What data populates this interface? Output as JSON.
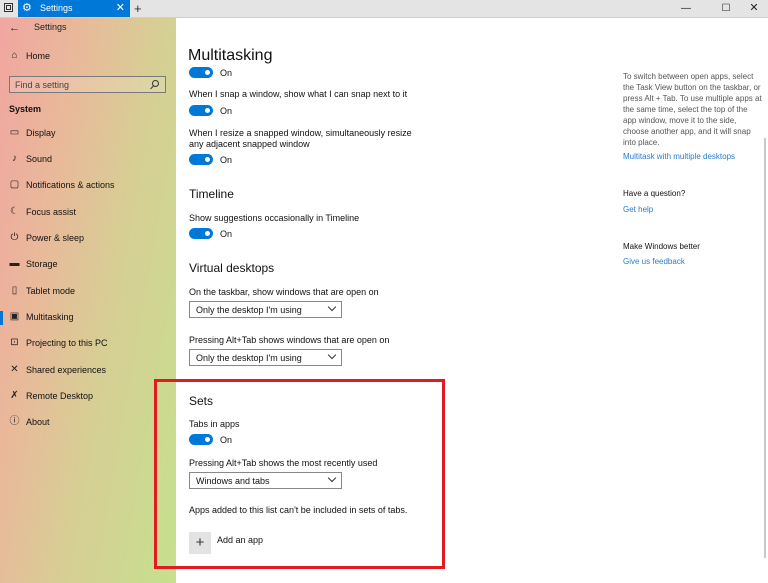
{
  "window": {
    "tab_title": "Settings",
    "app_title": "Settings",
    "new_tab": "+",
    "close_tab": "✕",
    "controls": {
      "minimize": "—",
      "maximize": "☐",
      "close": "✕"
    }
  },
  "sidebar": {
    "back": "←",
    "home": {
      "label": "Home",
      "icon": "home-icon"
    },
    "search": {
      "placeholder": "Find a setting"
    },
    "section": "System",
    "items": [
      {
        "label": "Display",
        "icon": "display-icon"
      },
      {
        "label": "Sound",
        "icon": "sound-icon"
      },
      {
        "label": "Notifications & actions",
        "icon": "notifications-icon"
      },
      {
        "label": "Focus assist",
        "icon": "focus-assist-icon"
      },
      {
        "label": "Power & sleep",
        "icon": "power-icon"
      },
      {
        "label": "Storage",
        "icon": "storage-icon"
      },
      {
        "label": "Tablet mode",
        "icon": "tablet-icon"
      },
      {
        "label": "Multitasking",
        "icon": "multitasking-icon",
        "selected": true
      },
      {
        "label": "Projecting to this PC",
        "icon": "projecting-icon"
      },
      {
        "label": "Shared experiences",
        "icon": "shared-icon"
      },
      {
        "label": "Remote Desktop",
        "icon": "remote-desktop-icon"
      },
      {
        "label": "About",
        "icon": "about-icon"
      }
    ]
  },
  "main": {
    "title": "Multitasking",
    "snap": {
      "toggle1": "On",
      "option2": "When I snap a window, show what I can snap next to it",
      "toggle2": "On",
      "option3": "When I resize a snapped window, simultaneously resize any adjacent snapped window",
      "toggle3": "On"
    },
    "timeline": {
      "heading": "Timeline",
      "option": "Show suggestions occasionally in Timeline",
      "toggle": "On"
    },
    "virtual_desktops": {
      "heading": "Virtual desktops",
      "taskbar_label": "On the taskbar, show windows that are open on",
      "taskbar_value": "Only the desktop I'm using",
      "alttab_label": "Pressing Alt+Tab shows windows that are open on",
      "alttab_value": "Only the desktop I'm using"
    },
    "sets": {
      "heading": "Sets",
      "tabs_label": "Tabs in apps",
      "tabs_toggle": "On",
      "alttab_label": "Pressing Alt+Tab shows the most recently used",
      "alttab_value": "Windows and tabs",
      "exclusion_note": "Apps added to this list can't be included in sets of tabs.",
      "add_icon": "+",
      "add_label": "Add an app"
    }
  },
  "right_panel": {
    "help_text": "To switch between open apps, select the Task View button on the taskbar, or press Alt + Tab. To use multiple apps at the same time, select the top of the app window, move it to the side, choose another app, and it will snap into place.",
    "help_link": "Multitask with multiple desktops",
    "question_heading": "Have a question?",
    "question_link": "Get help",
    "feedback_heading": "Make Windows better",
    "feedback_link": "Give us feedback"
  },
  "colors": {
    "accent": "#0078d7",
    "link": "#2a7bd1",
    "highlight_box": "#e21b22"
  }
}
